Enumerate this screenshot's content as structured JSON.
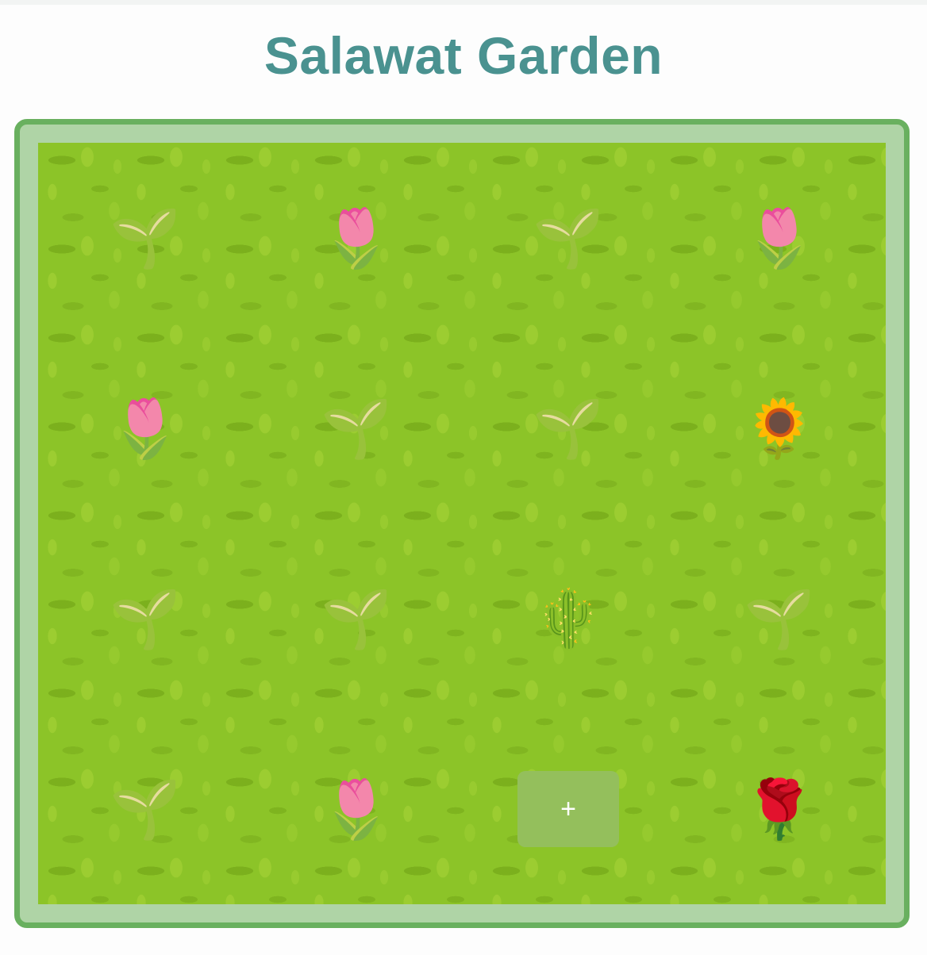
{
  "header": {
    "title": "Salawat Garden"
  },
  "garden": {
    "add_label": "+",
    "plots": [
      {
        "row": 0,
        "col": 0,
        "plant": "seedling",
        "glyph": "🌱"
      },
      {
        "row": 0,
        "col": 1,
        "plant": "tulip",
        "glyph": "🌷"
      },
      {
        "row": 0,
        "col": 2,
        "plant": "seedling",
        "glyph": "🌱"
      },
      {
        "row": 0,
        "col": 3,
        "plant": "tulip",
        "glyph": "🌷"
      },
      {
        "row": 1,
        "col": 0,
        "plant": "tulip",
        "glyph": "🌷"
      },
      {
        "row": 1,
        "col": 1,
        "plant": "seedling",
        "glyph": "🌱"
      },
      {
        "row": 1,
        "col": 2,
        "plant": "seedling",
        "glyph": "🌱"
      },
      {
        "row": 1,
        "col": 3,
        "plant": "sunflower",
        "glyph": "🌻"
      },
      {
        "row": 2,
        "col": 0,
        "plant": "seedling",
        "glyph": "🌱"
      },
      {
        "row": 2,
        "col": 1,
        "plant": "seedling",
        "glyph": "🌱"
      },
      {
        "row": 2,
        "col": 2,
        "plant": "cactus",
        "glyph": "🌵"
      },
      {
        "row": 2,
        "col": 3,
        "plant": "seedling",
        "glyph": "🌱"
      },
      {
        "row": 3,
        "col": 0,
        "plant": "seedling",
        "glyph": "🌱"
      },
      {
        "row": 3,
        "col": 1,
        "plant": "tulip",
        "glyph": "🌷"
      },
      {
        "row": 3,
        "col": 3,
        "plant": "rose",
        "glyph": "🌹"
      }
    ],
    "add_slot": {
      "row": 3,
      "col": 2
    }
  },
  "colors": {
    "title": "#4a9290",
    "frame_border": "#69b05f",
    "frame_fill": "#afd4a6",
    "grass": "#8cc428",
    "add_button": "#94bf5c"
  }
}
